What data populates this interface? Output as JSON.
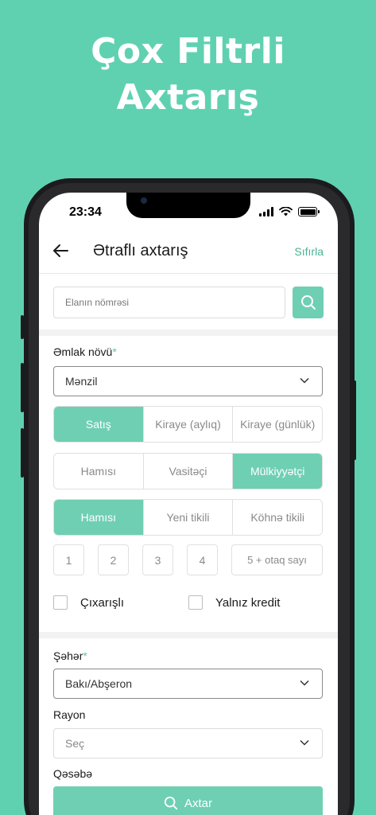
{
  "headline": {
    "line1": "Çox Filtrli",
    "line2": "Axtarış"
  },
  "status_bar": {
    "time": "23:34"
  },
  "topbar": {
    "title": "Ətraflı axtarış",
    "reset_label": "Sıfırla"
  },
  "search": {
    "placeholder": "Elanın nömrəsi",
    "value": ""
  },
  "property_type": {
    "label": "Əmlak növü",
    "required_mark": "*",
    "selected": "Mənzil"
  },
  "deal_type": {
    "options": [
      "Satış",
      "Kiraye (aylıq)",
      "Kiraye (günlük)"
    ],
    "active": 0
  },
  "seller_type": {
    "options": [
      "Hamısı",
      "Vasitəçi",
      "Mülkiyyətçi"
    ],
    "active": 2
  },
  "building_type": {
    "options": [
      "Hamısı",
      "Yeni tikili",
      "Köhnə tikili"
    ],
    "active": 0
  },
  "rooms": {
    "options": [
      "1",
      "2",
      "3",
      "4"
    ],
    "more_label": "5 + otaq sayı"
  },
  "checkboxes": {
    "extract": {
      "label": "Çıxarışlı",
      "checked": false
    },
    "credit": {
      "label": "Yalnız kredit",
      "checked": false
    }
  },
  "city": {
    "label": "Şəhər",
    "required_mark": "*",
    "selected": "Bakı/Abşeron"
  },
  "district": {
    "label": "Rayon",
    "selected": "Seç"
  },
  "settlement": {
    "label": "Qəsəbə"
  },
  "submit": {
    "label": "Axtar"
  },
  "colors": {
    "background": "#5fd1b1",
    "accent": "#6fcfb3",
    "accent_text": "#47b395"
  }
}
